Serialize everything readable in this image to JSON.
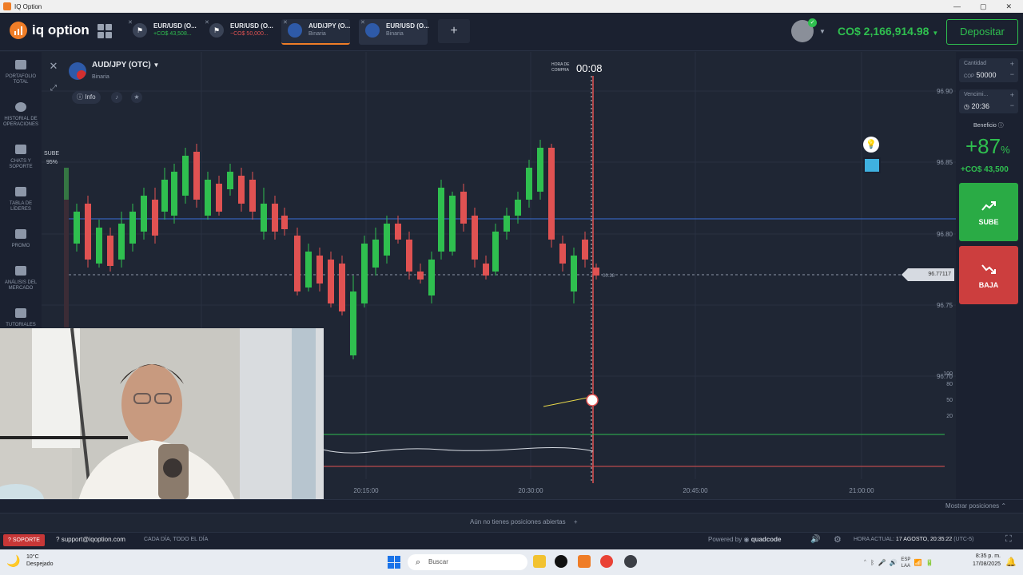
{
  "window": {
    "title": "IQ Option"
  },
  "header": {
    "logo_text": "iq option",
    "tabs": [
      {
        "name": "EUR/USD (O...",
        "sub": "+CO$ 43,508...",
        "sub_color": "#2fbf4f"
      },
      {
        "name": "EUR/USD (O...",
        "sub": "−CO$ 50,000...",
        "sub_color": "#e05252"
      },
      {
        "name": "AUD/JPY (O...",
        "sub": "Binaria",
        "sub_color": "#8d97a8"
      },
      {
        "name": "EUR/USD (O...",
        "sub": "Binaria",
        "sub_color": "#8d97a8"
      }
    ],
    "balance": "CO$ 2,166,914.98",
    "deposit_label": "Depositar"
  },
  "sidebar": {
    "items": [
      {
        "label": "PORTAFOLIO TOTAL"
      },
      {
        "label": "HISTORIAL DE OPERACIONES"
      },
      {
        "label": "CHATS Y SOPORTE"
      },
      {
        "label": "TABLA DE LÍDERES"
      },
      {
        "label": "PROMO"
      },
      {
        "label": "ANÁLISIS DEL MERCADO"
      },
      {
        "label": "TUTORIALES"
      }
    ]
  },
  "asset": {
    "name": "AUD/JPY (OTC)",
    "type": "Binaria",
    "info_label": "Info",
    "sube_label": "SUBE",
    "sube_pct": "95%",
    "purchase_label_1": "HORA DE",
    "purchase_label_2": "COMPRA",
    "purchase_time": "00:08",
    "current_price": "96.77117",
    "price_line_timer": "00:38"
  },
  "chart_data": {
    "type": "candlestick",
    "y_ticks": [
      "96.90",
      "96.85",
      "96.80",
      "96.75",
      "96.70"
    ],
    "x_ticks": [
      "20:15:00",
      "20:30:00",
      "20:45:00",
      "21:00:00"
    ],
    "oscillator_ticks": [
      "100",
      "80",
      "50",
      "20"
    ],
    "colors": {
      "up": "#2fbf4f",
      "down": "#e05252",
      "price_line": "#3a6fd8"
    }
  },
  "trade_panel": {
    "amount_label": "Cantidad",
    "amount_currency": "COP",
    "amount_value": "50000",
    "expiry_label": "Vencimi...",
    "expiry_value": "20:36",
    "profit_label": "Beneficio",
    "profit_pct": "+87",
    "profit_pct_sign": "%",
    "profit_value": "+CO$ 43,500",
    "up_label": "SUBE",
    "down_label": "BAJA"
  },
  "footer": {
    "show_positions": "Mostrar posiciones",
    "no_positions": "Aún no tienes posiciones abiertas",
    "support_btn": "SOPORTE",
    "support_email": "support@iqoption.com",
    "support_hours": "CADA DÍA, TODO EL DÍA",
    "powered_by": "Powered by",
    "powered_brand": "quadcode",
    "current_time_label": "HORA ACTUAL:",
    "current_time_value": "17 AGOSTO, 20:35:22",
    "timezone": "(UTC-5)"
  },
  "taskbar": {
    "weather_temp": "10°C",
    "weather_desc": "Despejado",
    "search_placeholder": "Buscar",
    "lang": "ESP",
    "lang_sub": "LAA",
    "clock_time": "8:35 p. m.",
    "clock_date": "17/08/2025"
  }
}
